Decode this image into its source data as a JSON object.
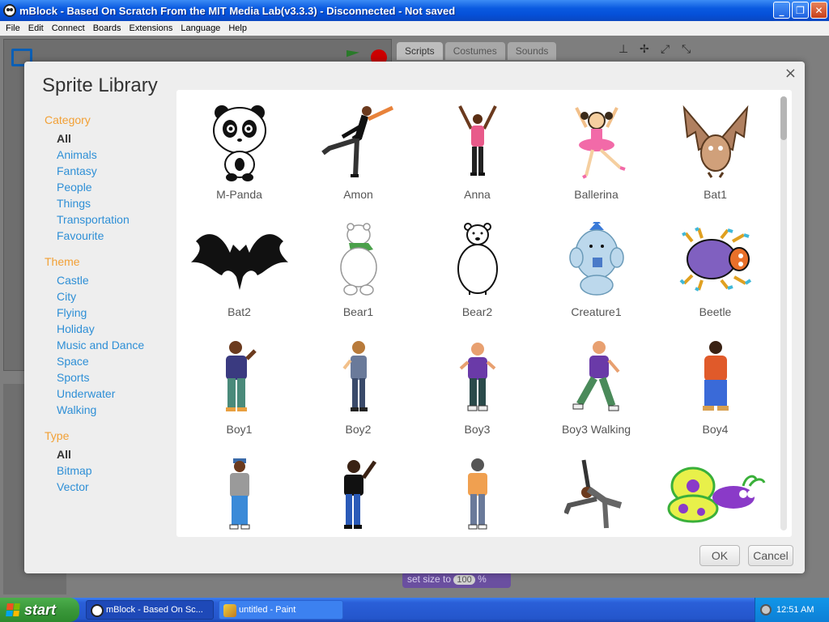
{
  "window": {
    "title": "mBlock - Based On Scratch From the MIT Media Lab(v3.3.3) - Disconnected - Not saved",
    "buttons": {
      "minimize": "_",
      "maximize": "❐",
      "close": "✕"
    }
  },
  "menu": [
    {
      "label": "File"
    },
    {
      "label": "Edit"
    },
    {
      "label": "Connect"
    },
    {
      "label": "Boards"
    },
    {
      "label": "Extensions"
    },
    {
      "label": "Language"
    },
    {
      "label": "Help"
    }
  ],
  "app": {
    "tabs": [
      {
        "label": "Scripts"
      },
      {
        "label": "Costumes"
      },
      {
        "label": "Sounds"
      }
    ],
    "block": {
      "text": "set size to",
      "value": "100",
      "unit": "%"
    }
  },
  "modal": {
    "title": "Sprite Library",
    "close": "×",
    "category": {
      "heading": "Category",
      "items": [
        "All",
        "Animals",
        "Fantasy",
        "People",
        "Things",
        "Transportation",
        "Favourite"
      ],
      "selected": "All"
    },
    "theme": {
      "heading": "Theme",
      "items": [
        "Castle",
        "City",
        "Flying",
        "Holiday",
        "Music and Dance",
        "Space",
        "Sports",
        "Underwater",
        "Walking"
      ]
    },
    "type": {
      "heading": "Type",
      "items": [
        "All",
        "Bitmap",
        "Vector"
      ],
      "selected": "All"
    },
    "sprites": [
      {
        "name": "M-Panda",
        "icon": "panda-icon"
      },
      {
        "name": "Amon",
        "icon": "person-icon"
      },
      {
        "name": "Anna",
        "icon": "person-icon"
      },
      {
        "name": "Ballerina",
        "icon": "ballerina-icon"
      },
      {
        "name": "Bat1",
        "icon": "bat-icon"
      },
      {
        "name": "Bat2",
        "icon": "bat-silhouette-icon"
      },
      {
        "name": "Bear1",
        "icon": "polar-bear-icon"
      },
      {
        "name": "Bear2",
        "icon": "bear-outline-icon"
      },
      {
        "name": "Creature1",
        "icon": "creature-icon"
      },
      {
        "name": "Beetle",
        "icon": "beetle-icon"
      },
      {
        "name": "Boy1",
        "icon": "boy-icon"
      },
      {
        "name": "Boy2",
        "icon": "boy-icon"
      },
      {
        "name": "Boy3",
        "icon": "boy-icon"
      },
      {
        "name": "Boy3 Walking",
        "icon": "boy-walking-icon"
      },
      {
        "name": "Boy4",
        "icon": "boy-icon"
      },
      {
        "name": "",
        "icon": "boy-icon"
      },
      {
        "name": "",
        "icon": "boy-icon"
      },
      {
        "name": "",
        "icon": "boy-icon"
      },
      {
        "name": "",
        "icon": "breakdancer-icon"
      },
      {
        "name": "",
        "icon": "butterfly-icon"
      }
    ],
    "ok": "OK",
    "cancel": "Cancel"
  },
  "taskbar": {
    "start": "start",
    "tasks": [
      {
        "label": "mBlock - Based On Sc..."
      },
      {
        "label": "untitled - Paint"
      }
    ],
    "clock": "12:51 AM"
  }
}
